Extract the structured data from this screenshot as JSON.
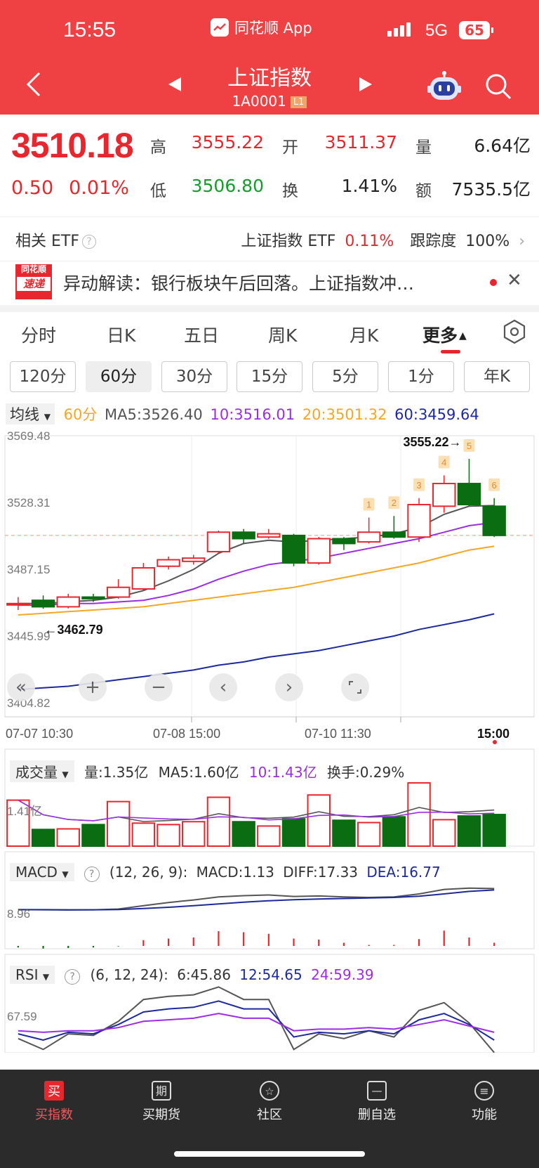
{
  "status": {
    "time": "15:55",
    "network": "5G",
    "battery": "65"
  },
  "app": {
    "name": "同花顺 App"
  },
  "header": {
    "title": "上证指数",
    "code": "1A0001",
    "level": "L1"
  },
  "quote": {
    "price": "3510.18",
    "change": "0.50",
    "change_pct": "0.01%",
    "labels": {
      "high": "高",
      "low": "低",
      "open": "开",
      "turnover": "换",
      "volume": "量",
      "amount": "额"
    },
    "high": "3555.22",
    "low": "3506.80",
    "open": "3511.37",
    "turnover": "1.41%",
    "volume": "6.64亿",
    "amount": "7535.5亿"
  },
  "etf": {
    "label": "相关 ETF",
    "name": "上证指数 ETF",
    "pct": "0.11%",
    "track_label": "跟踪度",
    "track": "100%"
  },
  "news": {
    "logo_top": "同花顺",
    "logo_bottom": "速递",
    "text": "异动解读：银行板块午后回落。上证指数冲…"
  },
  "tabs": [
    "分时",
    "日K",
    "五日",
    "周K",
    "月K",
    "更多"
  ],
  "periods": [
    "120分",
    "60分",
    "30分",
    "15分",
    "5分",
    "1分",
    "年K"
  ],
  "ma": {
    "selector": "均线",
    "period": "60分",
    "ma5": "MA5:3526.40",
    "ma10": "10:3516.01",
    "ma20": "20:3501.32",
    "ma60": "60:3459.64"
  },
  "colors": {
    "up": "#e8262e",
    "down": "#0a6d12",
    "ma5": "#555555",
    "ma10": "#9b2ee3",
    "ma20": "#f5a623",
    "ma60": "#1c2a9e"
  },
  "chart_data": {
    "type": "candlestick",
    "ylim": [
      3404.82,
      3569.48
    ],
    "y_ticks": [
      "3569.48",
      "3528.31",
      "3487.15",
      "3445.99",
      "3404.82"
    ],
    "x_labels": [
      "07-07 10:30",
      "07-08 15:00",
      "07-10 11:30",
      "15:00"
    ],
    "max_annotation": "3555.22→",
    "min_annotation": "←3462.79",
    "event_markers": [
      "1",
      "2",
      "3",
      "4",
      "5",
      "6"
    ],
    "candles": [
      {
        "o": 3466,
        "c": 3466,
        "h": 3470,
        "l": 3462
      },
      {
        "o": 3468,
        "c": 3464,
        "h": 3471,
        "l": 3462.79
      },
      {
        "o": 3464,
        "c": 3470,
        "h": 3472,
        "l": 3463
      },
      {
        "o": 3470,
        "c": 3469,
        "h": 3472,
        "l": 3467
      },
      {
        "o": 3470,
        "c": 3476,
        "h": 3481,
        "l": 3469
      },
      {
        "o": 3475,
        "c": 3488,
        "h": 3491,
        "l": 3474
      },
      {
        "o": 3489,
        "c": 3493,
        "h": 3495,
        "l": 3487
      },
      {
        "o": 3492,
        "c": 3494,
        "h": 3496,
        "l": 3490
      },
      {
        "o": 3498,
        "c": 3510,
        "h": 3511,
        "l": 3497
      },
      {
        "o": 3510,
        "c": 3506,
        "h": 3512,
        "l": 3503
      },
      {
        "o": 3507,
        "c": 3509,
        "h": 3512,
        "l": 3506
      },
      {
        "o": 3508,
        "c": 3491,
        "h": 3509,
        "l": 3489
      },
      {
        "o": 3491,
        "c": 3506,
        "h": 3507,
        "l": 3490
      },
      {
        "o": 3506,
        "c": 3503,
        "h": 3507,
        "l": 3499
      },
      {
        "o": 3504,
        "c": 3510,
        "h": 3519,
        "l": 3503
      },
      {
        "o": 3510,
        "c": 3507,
        "h": 3520,
        "l": 3506
      },
      {
        "o": 3507,
        "c": 3527,
        "h": 3531,
        "l": 3504
      },
      {
        "o": 3526,
        "c": 3540,
        "h": 3545,
        "l": 3522
      },
      {
        "o": 3540,
        "c": 3527,
        "h": 3555.22,
        "l": 3526
      },
      {
        "o": 3526,
        "c": 3508,
        "h": 3531,
        "l": 3507
      }
    ],
    "ma5": [
      3466,
      3466,
      3467,
      3468,
      3470,
      3474,
      3480,
      3487,
      3497,
      3503,
      3505,
      3504,
      3505,
      3506,
      3507,
      3509,
      3513,
      3521,
      3526,
      3526.4
    ],
    "ma10": [
      3465,
      3465,
      3466,
      3466,
      3467,
      3468,
      3471,
      3475,
      3481,
      3486,
      3490,
      3492,
      3494,
      3497,
      3500,
      3503,
      3506,
      3510,
      3514,
      3516.01
    ],
    "ma20": [
      3459,
      3460,
      3461,
      3462,
      3463,
      3464,
      3466,
      3468,
      3470,
      3472,
      3474,
      3476,
      3479,
      3482,
      3485,
      3488,
      3491,
      3495,
      3499,
      3501.32
    ],
    "ma60": [
      3413,
      3414,
      3415,
      3417,
      3419,
      3421,
      3423,
      3425,
      3428,
      3430,
      3433,
      3435,
      3437,
      3440,
      3443,
      3446,
      3450,
      3453,
      3456,
      3459.64
    ]
  },
  "volume": {
    "selector": "成交量",
    "vol": "量:1.35亿",
    "ma5": "MA5:1.60亿",
    "ma10": "10:1.43亿",
    "turn": "换手:0.29%",
    "tick": "1.41亿",
    "bars": [
      1.6,
      0.58,
      0.6,
      0.75,
      1.55,
      0.8,
      0.75,
      0.85,
      1.7,
      0.85,
      0.7,
      0.95,
      1.78,
      0.9,
      0.82,
      1.02,
      2.2,
      0.92,
      1.05,
      1.1
    ],
    "up": [
      1,
      0,
      1,
      0,
      1,
      1,
      1,
      1,
      1,
      0,
      1,
      0,
      1,
      0,
      1,
      0,
      1,
      1,
      0,
      0
    ]
  },
  "macd": {
    "selector": "MACD",
    "params": "(12, 26, 9):",
    "macd": "MACD:1.13",
    "diff": "DIFF:17.33",
    "dea": "DEA:16.77",
    "tick": "8.96",
    "diff_line": [
      8.96,
      8.9,
      8.8,
      8.9,
      9.2,
      10.5,
      11.8,
      12.8,
      14,
      14.5,
      14.8,
      14.2,
      14.4,
      14,
      13.8,
      14,
      15.2,
      17,
      17.5,
      17.33
    ],
    "dea_line": [
      8.96,
      8.94,
      8.9,
      8.9,
      9.0,
      9.4,
      9.9,
      10.5,
      11.2,
      11.9,
      12.5,
      12.9,
      13.2,
      13.4,
      13.6,
      13.8,
      14.3,
      15.2,
      16.2,
      16.77
    ],
    "hist": [
      -0.3,
      -0.5,
      -0.4,
      -0.3,
      -0.1,
      1.1,
      1.4,
      1.6,
      2.8,
      2.6,
      2.3,
      1.4,
      1.2,
      0.6,
      0.2,
      0.2,
      1.3,
      2.9,
      1.6,
      0.6
    ]
  },
  "rsi": {
    "selector": "RSI",
    "params": "(6, 12, 24):",
    "r6": "6:45.86",
    "r12": "12:54.65",
    "r24": "24:59.39",
    "tick": "67.59",
    "r6_line": [
      55,
      48,
      58,
      57,
      66,
      80,
      82,
      83,
      88,
      80,
      80,
      48,
      58,
      55,
      60,
      56,
      73,
      78,
      65,
      46
    ],
    "r12_line": [
      58,
      54,
      59,
      58,
      64,
      72,
      74,
      75,
      79,
      74,
      74,
      56,
      59,
      58,
      60,
      58,
      67,
      71,
      64,
      54
    ],
    "r24_line": [
      60,
      59,
      60,
      60,
      62,
      66,
      67,
      68,
      71,
      68,
      68,
      60,
      61,
      61,
      62,
      61,
      64,
      67,
      63,
      59
    ]
  },
  "nav": [
    {
      "label": "买指数",
      "icon": "买"
    },
    {
      "label": "买期货",
      "icon": "期"
    },
    {
      "label": "社区",
      "icon": "☆"
    },
    {
      "label": "删自选",
      "icon": "—"
    },
    {
      "label": "功能",
      "icon": "≡"
    }
  ]
}
